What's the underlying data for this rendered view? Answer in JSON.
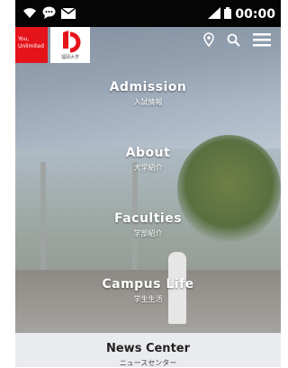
{
  "status_bar": {
    "time": "00:00",
    "icons": [
      "wifi-icon",
      "chat-icon",
      "mail-icon",
      "signal-icon",
      "battery-icon"
    ]
  },
  "logos": {
    "red_logo_line1": "You,",
    "red_logo_line2": "Unlimited",
    "white_logo_caption": "福岡大学"
  },
  "header_icons": [
    "location-icon",
    "search-icon",
    "menu-icon"
  ],
  "menu": [
    {
      "en": "Admission",
      "jp": "入試情報"
    },
    {
      "en": "About",
      "jp": "大学紹介"
    },
    {
      "en": "Faculties",
      "jp": "学部紹介"
    },
    {
      "en": "Campus Life",
      "jp": "学生生活"
    },
    {
      "en": "News Center",
      "jp": "ニュースセンター"
    }
  ],
  "colors": {
    "brand_red": "#e5141a",
    "status_bar": "#050505",
    "news_bg": "#e9ebee"
  }
}
